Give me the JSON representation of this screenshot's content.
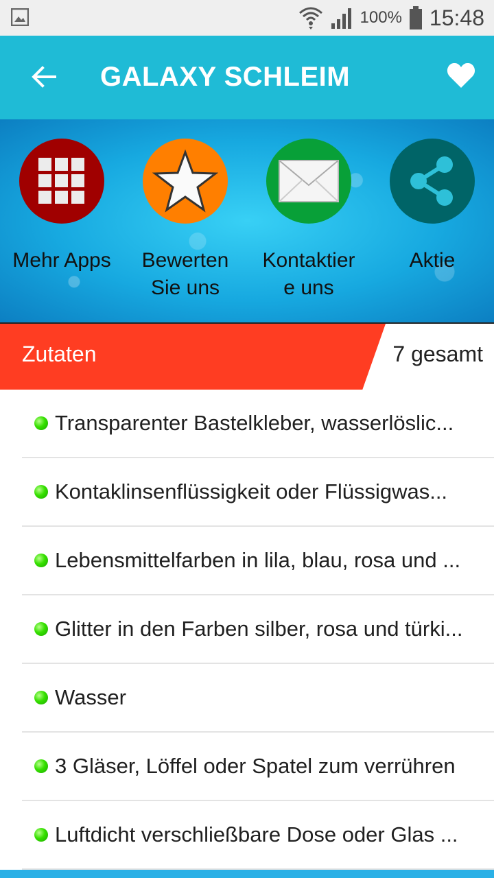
{
  "status_bar": {
    "battery": "100%",
    "time": "15:48",
    "icons": [
      "image-icon",
      "wifi-icon",
      "signal-icon",
      "battery-icon"
    ]
  },
  "app_bar": {
    "title": "GALAXY SCHLEIM",
    "back_icon": "arrow-left-icon",
    "favorite_icon": "heart-icon"
  },
  "actions": [
    {
      "label_line1": "Mehr Apps",
      "label_line2": "",
      "color": "#a00000",
      "icon": "grid-icon"
    },
    {
      "label_line1": "Bewerten",
      "label_line2": "Sie uns",
      "color": "#ff7f00",
      "icon": "star-icon"
    },
    {
      "label_line1": "Kontaktier",
      "label_line2": "e uns",
      "color": "#08a038",
      "icon": "mail-icon"
    },
    {
      "label_line1": "Aktie",
      "label_line2": "",
      "color": "#006467",
      "icon": "share-icon"
    }
  ],
  "section": {
    "title": "Zutaten",
    "count": "7 gesamt",
    "accent": "#ff3d22"
  },
  "ingredients": [
    "Transparenter Bastelkleber, wasserlöslic...",
    "Kontaklinsenflüssigkeit oder Flüssigwas...",
    "Lebensmittelfarben in lila, blau, rosa und ...",
    "Glitter in den Farben silber, rosa und türki...",
    "Wasser",
    "3 Gläser, Löffel oder Spatel zum verrühren",
    "Luftdicht verschließbare Dose oder Glas ..."
  ]
}
